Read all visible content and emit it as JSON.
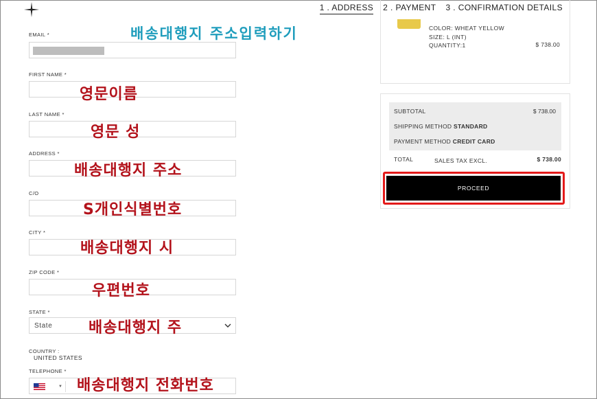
{
  "header": {
    "steps": [
      {
        "label": "1 . ADDRESS",
        "active": true
      },
      {
        "label": "2 . PAYMENT",
        "active": false
      },
      {
        "label": "3 . CONFIRMATION DETAILS",
        "active": false
      }
    ]
  },
  "form": {
    "title_annotation": "배송대행지 주소입력하기",
    "email": {
      "label": "EMAIL *"
    },
    "first_name": {
      "label": "FIRST NAME *",
      "annotation": "영문이름"
    },
    "last_name": {
      "label": "LAST NAME *",
      "annotation": "영문 성"
    },
    "address": {
      "label": "ADDRESS *",
      "annotation": "배송대행지 주소"
    },
    "co": {
      "label": "C/O",
      "annotation": "S개인식별번호"
    },
    "city": {
      "label": "CITY *",
      "annotation": "배송대행지 시"
    },
    "zip": {
      "label": "ZIP CODE *",
      "annotation": "우편번호"
    },
    "state": {
      "label": "STATE *",
      "value": "State",
      "annotation": "배송대행지 주"
    },
    "country": {
      "label": "COUNTRY :",
      "value": "UNITED STATES"
    },
    "telephone": {
      "label": "TELEPHONE *",
      "annotation": "배송대행지 전화번호"
    }
  },
  "product": {
    "color": "COLOR: WHEAT YELLOW",
    "size": "SIZE: L (INT)",
    "quantity": "QUANTITY:1",
    "price": "$ 738.00",
    "swatch_color": "#e8c94a"
  },
  "summary": {
    "subtotal_label": "SUBTOTAL",
    "subtotal_value": "$ 738.00",
    "shipping_prefix": "SHIPPING METHOD",
    "shipping_value": "STANDARD",
    "payment_prefix": "PAYMENT METHOD",
    "payment_value": "CREDIT CARD",
    "total_label": "TOTAL",
    "tax_note": "SALES TAX EXCL.",
    "total_value": "$ 738.00",
    "proceed_label": "PROCEED",
    "highlight_color": "#e41a1a"
  }
}
